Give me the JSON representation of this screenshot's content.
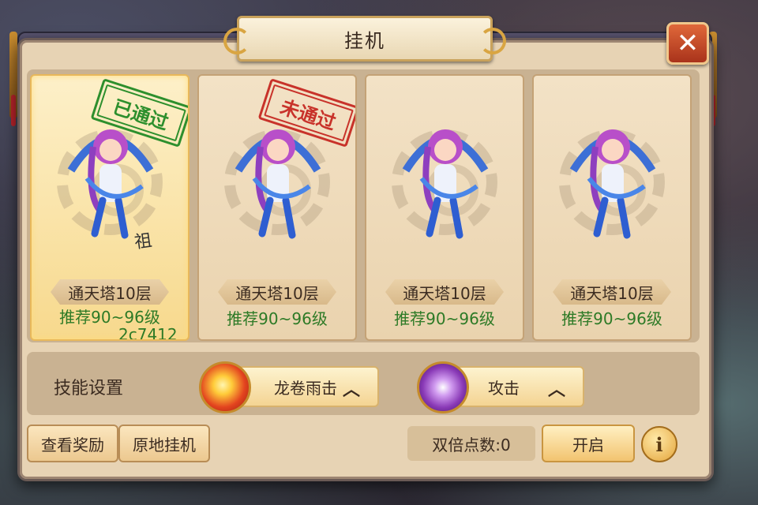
{
  "window": {
    "title": "挂机",
    "close_icon": "close-icon"
  },
  "stages": [
    {
      "tower": "通天塔10层",
      "recommend": "推荐90~96级",
      "stamp": "已通过",
      "stamp_color": "#2d8f2d",
      "selected": true
    },
    {
      "tower": "通天塔10层",
      "recommend": "推荐90~96级",
      "stamp": "未通过",
      "stamp_color": "#c8322a",
      "selected": false
    },
    {
      "tower": "通天塔10层",
      "recommend": "推荐90~96级",
      "stamp": "",
      "selected": false
    },
    {
      "tower": "通天塔10层",
      "recommend": "推荐90~96级",
      "stamp": "",
      "selected": false
    }
  ],
  "overlay_text": {
    "scribble": "祖",
    "code": "2c7412"
  },
  "skills": {
    "label": "技能设置",
    "slot1": {
      "name": "龙卷雨击",
      "icon": "fire-orb-icon"
    },
    "slot2": {
      "name": "攻击",
      "icon": "purple-vortex-icon"
    }
  },
  "footer": {
    "view_rewards": "查看奖励",
    "idle_here": "原地挂机",
    "double_points": "双倍点数:0",
    "start": "开启",
    "info_icon": "i"
  }
}
